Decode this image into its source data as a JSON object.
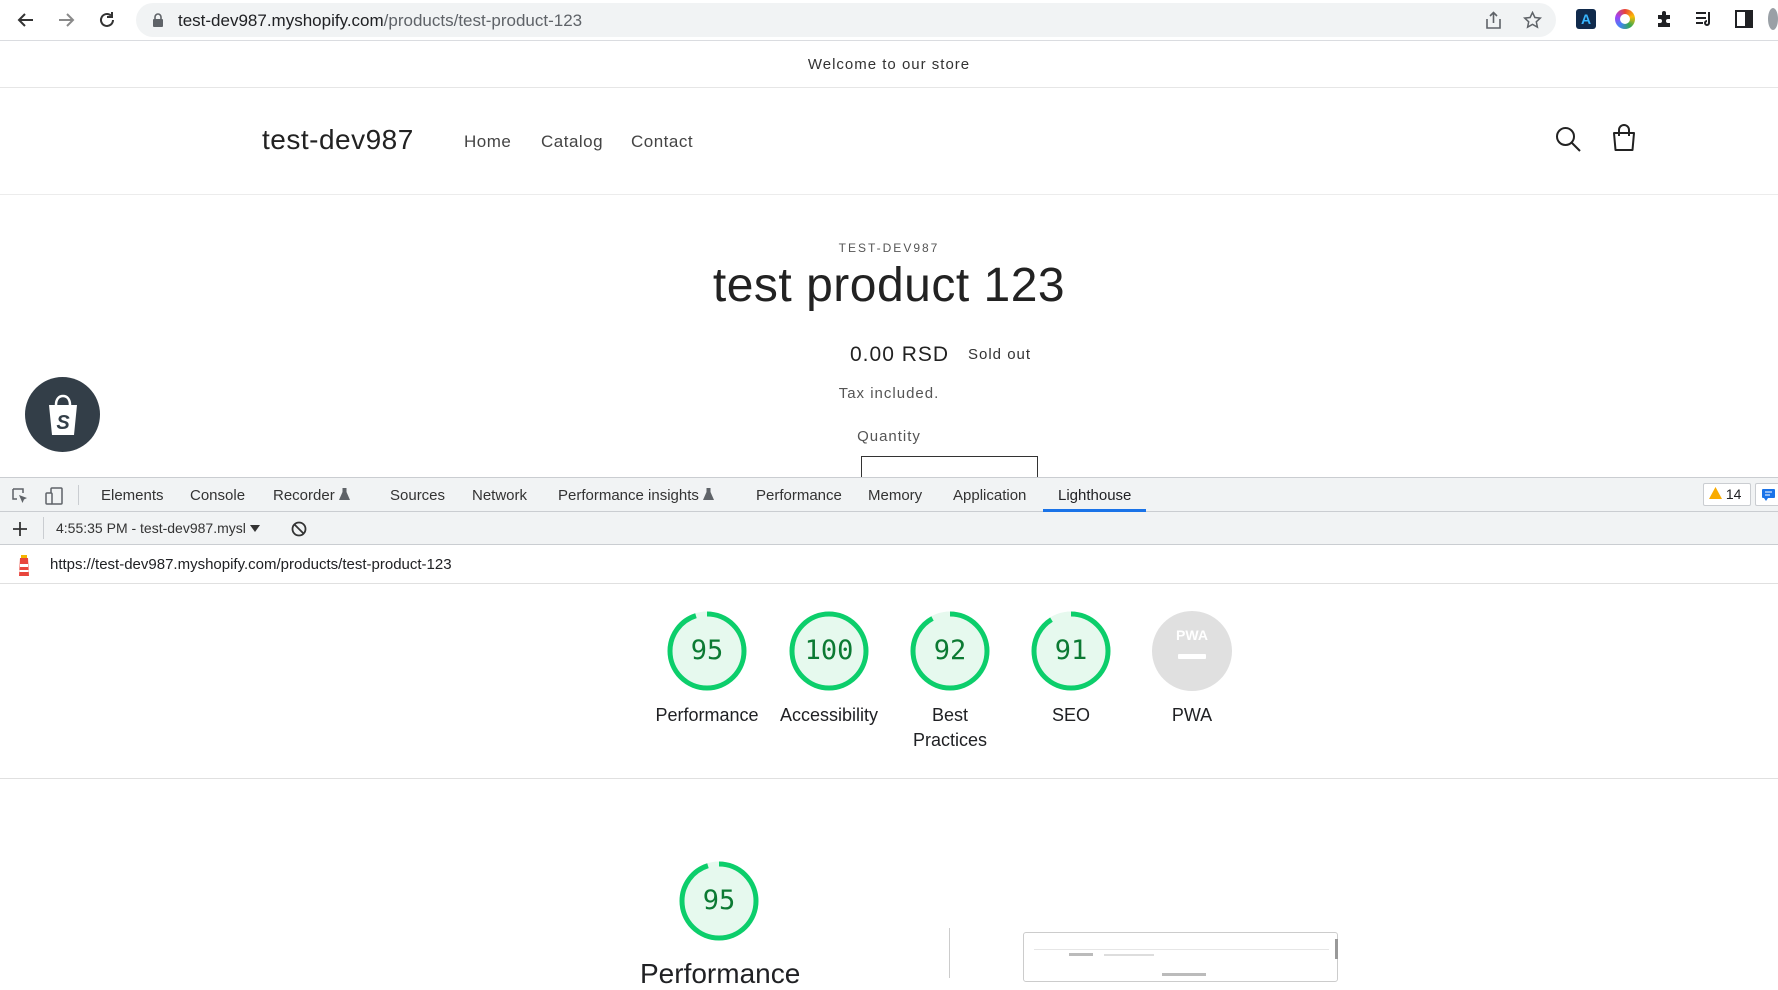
{
  "browser": {
    "url_domain": "test-dev987.myshopify.com",
    "url_path": "/products/test-product-123"
  },
  "store": {
    "announcement": "Welcome to our store",
    "shop_name": "test-dev987",
    "nav": [
      "Home",
      "Catalog",
      "Contact"
    ],
    "vendor": "TEST-DEV987",
    "product_title": "test product 123",
    "price": "0.00 RSD",
    "sold_out": "Sold out",
    "tax_note": "Tax included.",
    "quantity_label": "Quantity"
  },
  "devtools": {
    "tabs": [
      "Elements",
      "Console",
      "Recorder",
      "Sources",
      "Network",
      "Performance insights",
      "Performance",
      "Memory",
      "Application",
      "Lighthouse"
    ],
    "active_tab": "Lighthouse",
    "warnings_count": "14",
    "report_selector": "4:55:35 PM - test-dev987.mysl",
    "report_url": "https://test-dev987.myshopify.com/products/test-product-123"
  },
  "lighthouse": {
    "scores": [
      {
        "label": "Performance",
        "score": 95
      },
      {
        "label": "Accessibility",
        "score": 100
      },
      {
        "label": "Best",
        "label2": "Practices",
        "score": 92
      },
      {
        "label": "SEO",
        "score": 91
      },
      {
        "label": "PWA",
        "score": null,
        "badge": "PWA"
      }
    ],
    "main_score": "95",
    "main_label": "Performance",
    "score_color": "#0cce6b",
    "score_text_color": "#0c7a33"
  }
}
